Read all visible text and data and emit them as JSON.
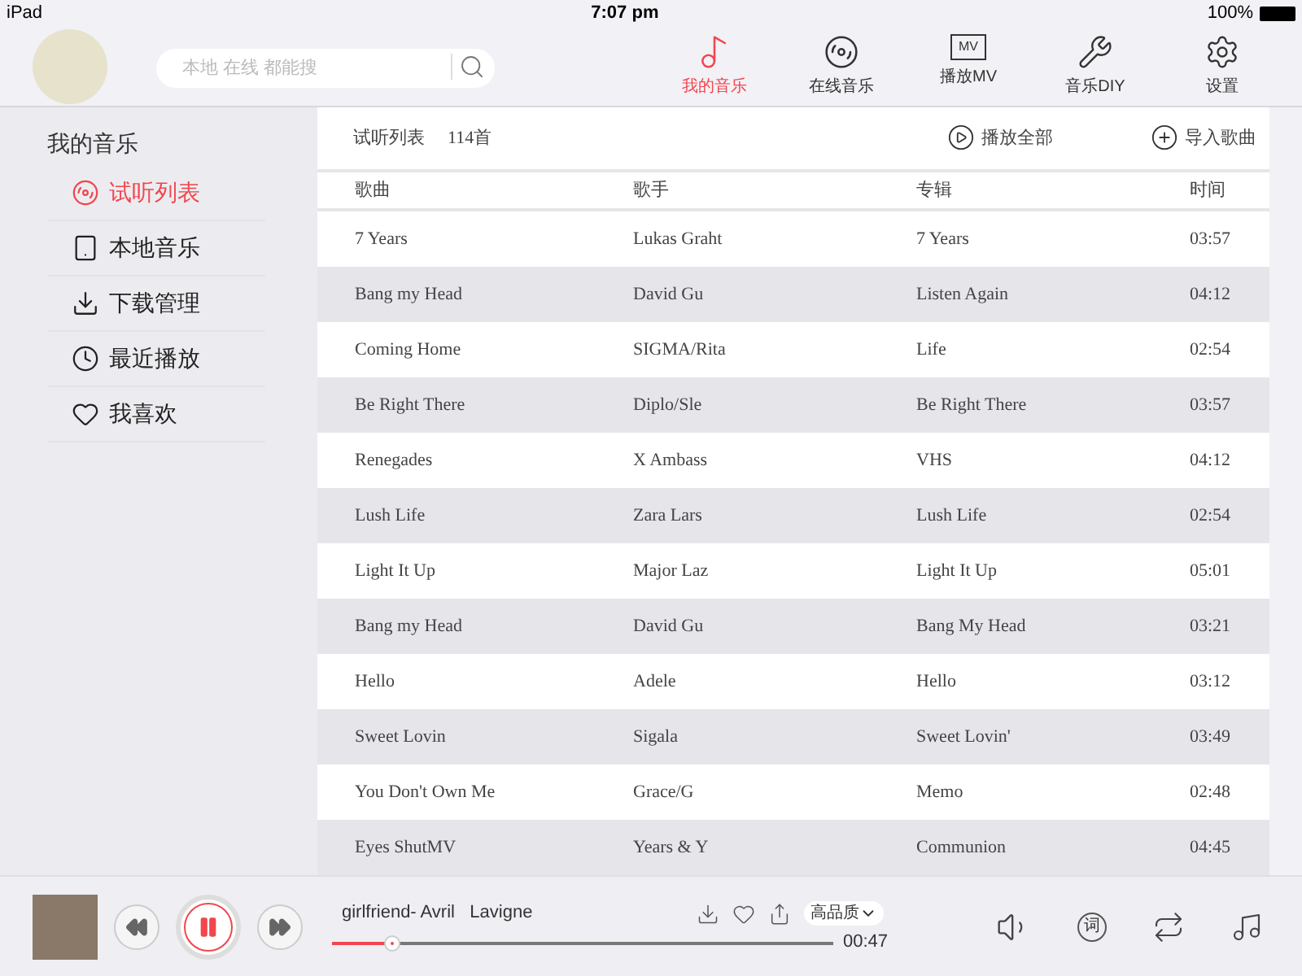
{
  "status_bar": {
    "device": "iPad",
    "time": "7:07 pm",
    "battery": "100%"
  },
  "search": {
    "placeholder": "本地 在线 都能搜"
  },
  "nav": [
    {
      "label": "我的音乐",
      "selected": true
    },
    {
      "label": "在线音乐",
      "selected": false
    },
    {
      "label": "播放MV",
      "selected": false,
      "icon_text": "MV"
    },
    {
      "label": "音乐DIY",
      "selected": false
    },
    {
      "label": "设置",
      "selected": false
    }
  ],
  "sidebar": {
    "title": "我的音乐",
    "items": [
      {
        "label": "试听列表",
        "selected": true
      },
      {
        "label": "本地音乐",
        "selected": false
      },
      {
        "label": "下载管理",
        "selected": false
      },
      {
        "label": "最近播放",
        "selected": false
      },
      {
        "label": "我喜欢",
        "selected": false
      }
    ]
  },
  "list": {
    "title": "试听列表",
    "count": "114首",
    "play_all": "播放全部",
    "import": "导入歌曲",
    "columns": [
      "歌曲",
      "歌手",
      "专辑",
      "时间"
    ],
    "rows": [
      [
        "7 Years",
        "Lukas Graht",
        "7 Years",
        "03:57"
      ],
      [
        "Bang my Head",
        "David Gu",
        "Listen Again",
        "04:12"
      ],
      [
        "Coming Home",
        "SIGMA/Rita",
        "Life",
        "02:54"
      ],
      [
        "Be Right There",
        "Diplo/Sle",
        "Be Right There",
        "03:57"
      ],
      [
        "Renegades",
        "X Ambass",
        "VHS",
        "04:12"
      ],
      [
        "Lush Life",
        "Zara Lars",
        "Lush Life",
        "02:54"
      ],
      [
        "Light It Up",
        "Major Laz",
        "Light It Up",
        "05:01"
      ],
      [
        "Bang my Head",
        "David Gu",
        "Bang My Head",
        "03:21"
      ],
      [
        "Hello",
        "Adele",
        "Hello",
        "03:12"
      ],
      [
        "Sweet Lovin",
        "Sigala",
        "Sweet Lovin'",
        "03:49"
      ],
      [
        "You Don't Own Me",
        "Grace/G",
        "Memo",
        "02:48"
      ],
      [
        "Eyes ShutMV",
        "Years & Y",
        "Communion",
        "04:45"
      ]
    ]
  },
  "player": {
    "track": "girlfriend- Avril   Lavigne",
    "quality": "高品质",
    "elapsed": "00:47",
    "level": 0.12,
    "playing": true,
    "lyrics_icon": "词"
  }
}
